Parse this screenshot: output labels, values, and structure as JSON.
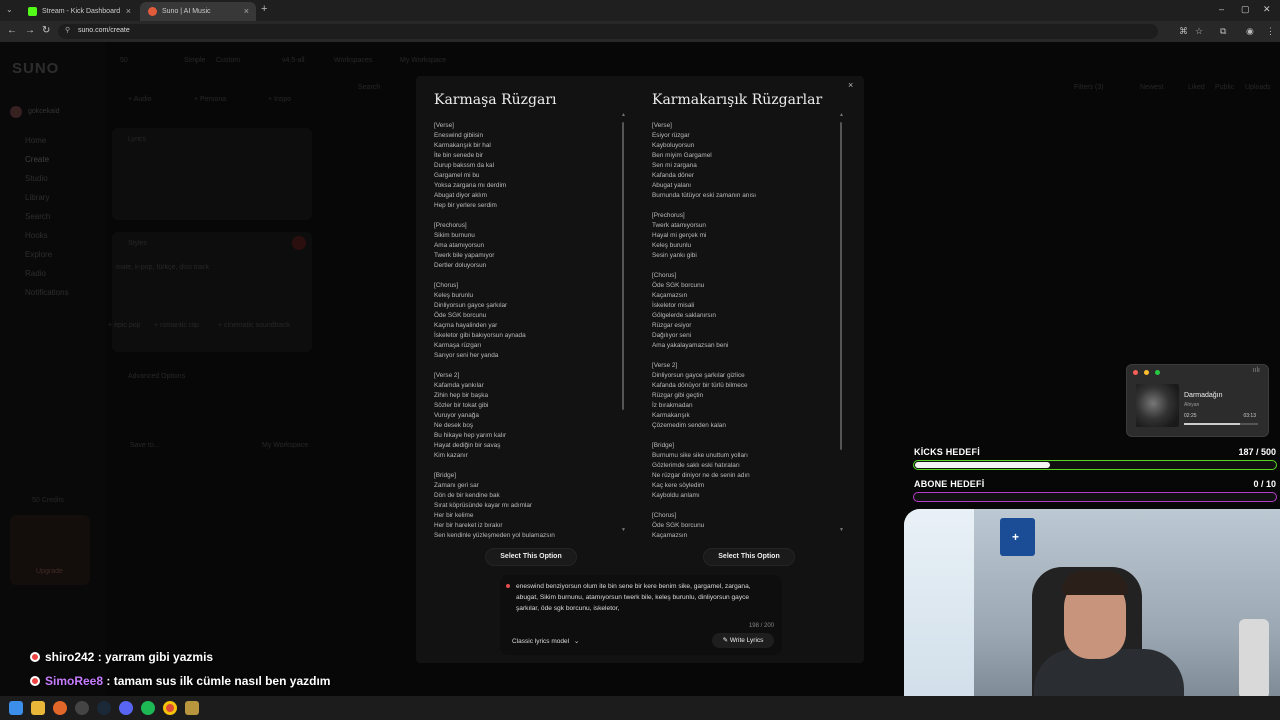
{
  "browser": {
    "tabs": [
      {
        "title": "Stream - Kick Dashboard",
        "favicon_color": "#53fc18",
        "active": false
      },
      {
        "title": "Suno | AI Music",
        "favicon_color": "#e25b3b",
        "active": true
      }
    ],
    "url": "suno.com/create"
  },
  "app": {
    "logo": "SUNO",
    "user": "gokcekaid",
    "sidebar": [
      "Home",
      "Create",
      "Studio",
      "Library",
      "Search",
      "Hooks",
      "Explore",
      "Radio",
      "Notifications"
    ],
    "toolbar": {
      "count": "50",
      "simple": "Simple",
      "custom": "Custom",
      "version": "v4.5-all",
      "workspaces": "Workspaces",
      "my_workspace": "My Workspace"
    },
    "create_buttons": [
      "+ Audio",
      "+ Persona",
      "+ Inspo"
    ],
    "lyrics_label": "Lyrics",
    "styles_label": "Styles",
    "styles_text": "male, k-pop, türkçe, diss track",
    "style_tags": [
      "+ epic pop",
      "+ romantic rap",
      "+ cinematic soundtrack"
    ],
    "advanced": "Advanced Options",
    "save_to": "Save to...",
    "save_ws": "My Workspace",
    "credits": "50 Credits",
    "upgrade": "Upgrade",
    "filters": [
      "Filters (3)",
      "Newest",
      "Liked",
      "Public",
      "Uploads"
    ],
    "search_placeholder": "Search"
  },
  "modal": {
    "close": "×",
    "options": [
      {
        "title": "Karmaşa Rüzgarı",
        "lyrics": "[Verse]\nEneswind gibiisin\nKarmakarışık bir hal\nİte bin senede bir\nDurup bakssm da kal\nGargamel mi bu\nYoksa zargana mı derdim\nAbugat diyor aklım\nHep bir yerlere serdim\n\n[Prechorus]\nSikim burnunu\nAma atamıyorsun\nTwerk bile yapamıyor\nDertler doluyorsun\n\n[Chorus]\nKeleş burunlu\nDinliyorsun gayce şarkılar\nÖde SGK borcunu\nKaçma hayalinden yar\nİskeletor gibi bakıyorsun aynada\nKarmaşa rüzgarı\nSarıyor seni her yanda\n\n[Verse 2]\nKafamda yankılar\nZihin hep bir başka\nSözler bir tokat gibi\nVuruyor yanağa\nNe desek boş\nBu hikaye hep yarım kalır\nHayat dediğin bir savaş\nKim kazanır\n\n[Bridge]\nZamanı geri sar\nDön de bir kendine bak\nSırat köprüsünde kayar mı adımlar\nHer bir kelime\nHer bir hareket iz bırakır\nSen kendinle yüzleşmeden yol bulamazsın",
        "select": "Select This Option",
        "thumb_pct": 72
      },
      {
        "title": "Karmakarışık Rüzgarlar",
        "lyrics": "[Verse]\nEsiyor rüzgar\nKayboluyorsun\nBen miyim Gargamel\nSen mi zargana\nKafanda döner\nAbugat yalanı\nBurnunda tütüyor eski zamanın anısı\n\n[Prechorus]\nTwerk atamıyorsun\nHayal mi gerçek mi\nKeleş burunlu\nSesin yankı gibi\n\n[Chorus]\nÖde SGK borcunu\nKaçamazsın\nİskeletor misali\nGölgelerde saklanırsın\nRüzgar esiyor\nDağılıyor seni\nAma yakalayamazsan beni\n\n[Verse 2]\nDinliyorsun gayce şarkılar gizlice\nKafanda dönüyor bir türlü bilmece\nRüzgar gibi geçtin\nİz bırakmadan\nKarmakarışık\nÇözemedim senden kalan\n\n[Bridge]\nBurnumu sike sike unuttum yolları\nGözlerimde saklı eski hatıraları\nNe rüzgar diniyor ne de senin adın\nKaç kere söyledim\nKayboldu anlamı\n\n[Chorus]\nÖde SGK borcunu\nKaçamazsın",
        "select": "Select This Option",
        "thumb_pct": 82
      }
    ],
    "prompt": "eneswind benziyorsun olum ite bin sene bir kere benim sike, gargamel, zargana, abugat, Sikim burnunu, atamıyorsun twerk bile, keleş burunlu, dinliyorsun gayce şarkılar, öde sgk borcunu, iskeletor,",
    "char_count": "198 / 200",
    "model": "Classic lyrics model",
    "write": "Write Lyrics"
  },
  "player": {
    "title": "Darmadağın",
    "artist": "Ahiyan",
    "current": "02:25",
    "total": "03:13",
    "progress_pct": 75
  },
  "goals": [
    {
      "label": "KİCKS HEDEFİ",
      "value": "187  / 500",
      "fraction": 0.374,
      "color": "#54d61f"
    },
    {
      "label": "ABONE HEDEFİ",
      "value": "0  / 10",
      "fraction": 0.0,
      "color": "#b53ac9"
    }
  ],
  "chat": [
    {
      "user": "shiro242",
      "message": ": yarram gibi yazmis"
    },
    {
      "user": "SimoRee8",
      "message": ": tamam sus ilk cümle nasıl ben yazdım"
    }
  ],
  "webcam": {
    "poster_text": "+"
  }
}
